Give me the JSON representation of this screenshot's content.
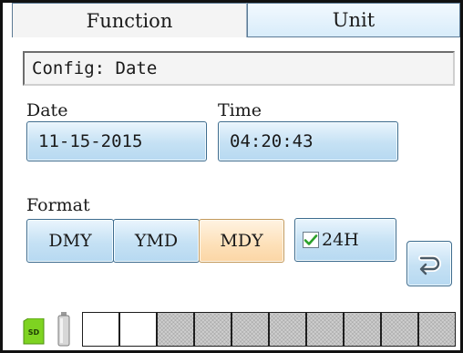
{
  "tabs": [
    {
      "label": "Function",
      "active": true
    },
    {
      "label": "Unit",
      "active": false
    }
  ],
  "config_label": "Config: Date",
  "date": {
    "label": "Date",
    "value": "11-15-2015"
  },
  "time": {
    "label": "Time",
    "value": "04:20:43"
  },
  "format": {
    "label": "Format",
    "options": [
      "DMY",
      "YMD",
      "MDY"
    ],
    "selected": "MDY"
  },
  "hour24": {
    "label": "24H",
    "checked": true
  },
  "icons": {
    "back": "back-return-icon",
    "sd": "sd-card-icon",
    "battery": "battery-icon"
  },
  "status": {
    "slots_total": 10,
    "slots_empty": 2
  },
  "colors": {
    "button": "#c5e1f4",
    "button_selected": "#fde0b8",
    "check": "#2aa02a",
    "sd_card": "#7ed321"
  }
}
